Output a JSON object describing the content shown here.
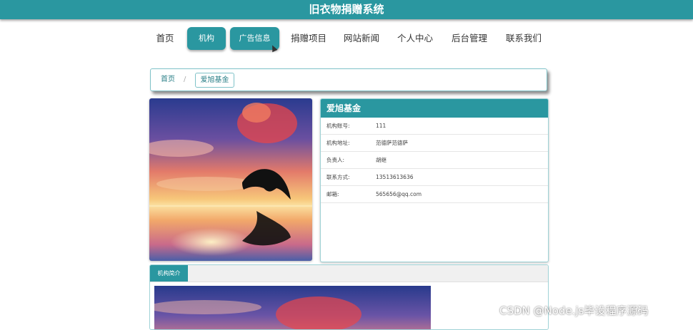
{
  "header": {
    "title": "旧衣物捐赠系统"
  },
  "nav": {
    "items": [
      {
        "label": "首页",
        "active": false
      },
      {
        "label": "机构",
        "active": true
      },
      {
        "label": "广告信息",
        "active": true
      },
      {
        "label": "捐赠项目",
        "active": false
      },
      {
        "label": "网站新闻",
        "active": false
      },
      {
        "label": "个人中心",
        "active": false
      },
      {
        "label": "后台管理",
        "active": false
      },
      {
        "label": "联系我们",
        "active": false
      }
    ]
  },
  "breadcrumb": {
    "home": "首页",
    "separator": "/",
    "current": "爱旭基金"
  },
  "org": {
    "name": "爱旭基金",
    "fields": [
      {
        "label": "机构账号:",
        "value": "111"
      },
      {
        "label": "机构地址:",
        "value": "范德萨范德萨"
      },
      {
        "label": "负责人:",
        "value": "胡继"
      },
      {
        "label": "联系方式:",
        "value": "13513613636"
      },
      {
        "label": "邮箱:",
        "value": "565656@qq.com"
      }
    ],
    "image_icon": "dolphin-sunset-image"
  },
  "intro": {
    "tab_label": "机构简介"
  },
  "watermark": {
    "text": "CSDN @Node.js毕设程序源码"
  },
  "colors": {
    "accent": "#2a97a0",
    "border": "#9fd2d6"
  }
}
